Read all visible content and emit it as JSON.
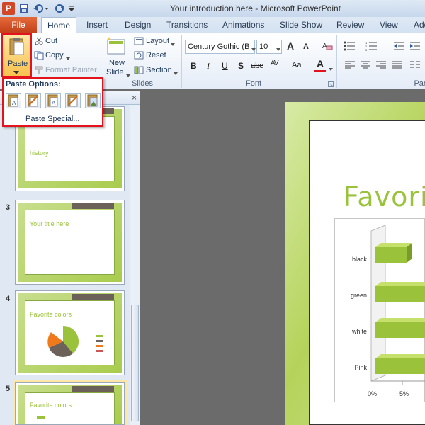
{
  "window": {
    "title": "Your introduction here - Microsoft PowerPoint",
    "app_icon_letter": "P"
  },
  "tabs": [
    "File",
    "Home",
    "Insert",
    "Design",
    "Transitions",
    "Animations",
    "Slide Show",
    "Review",
    "View",
    "Add"
  ],
  "ribbon": {
    "clipboard": {
      "paste": "Paste",
      "cut": "Cut",
      "copy": "Copy",
      "format_painter": "Format Painter",
      "group_label": ""
    },
    "slides": {
      "new_slide_line1": "New",
      "new_slide_line2": "Slide",
      "layout": "Layout",
      "reset": "Reset",
      "section": "Section",
      "group_label": "Slides"
    },
    "font": {
      "font_name": "Century Gothic (B",
      "font_size": "10",
      "group_label": "Font",
      "bold": "B",
      "italic": "I",
      "underline": "U",
      "strike": "S",
      "abc": "abc",
      "av": "AV",
      "aa": "Aa",
      "grow": "A",
      "shrink": "A",
      "color": "A"
    },
    "paragraph": {
      "group_label": "Par"
    }
  },
  "paste_menu": {
    "header": "Paste Options:",
    "paste_special": "Paste Special..."
  },
  "slides_panel": {
    "close": "×",
    "slides": [
      {
        "number": "",
        "text": "history"
      },
      {
        "number": "3",
        "text": "Your title here"
      },
      {
        "number": "4",
        "text": "Favorite colors"
      },
      {
        "number": "5",
        "text": "Favorite colors"
      }
    ]
  },
  "slide": {
    "title": "Favorit",
    "chart": {
      "categories": [
        "black",
        "green",
        "white",
        "Pink"
      ],
      "x_ticks": [
        "0%",
        "5%"
      ]
    }
  },
  "colors": {
    "accent_green": "#9bc23b",
    "file_tab": "#d24726",
    "highlight_red": "#e2131d"
  }
}
